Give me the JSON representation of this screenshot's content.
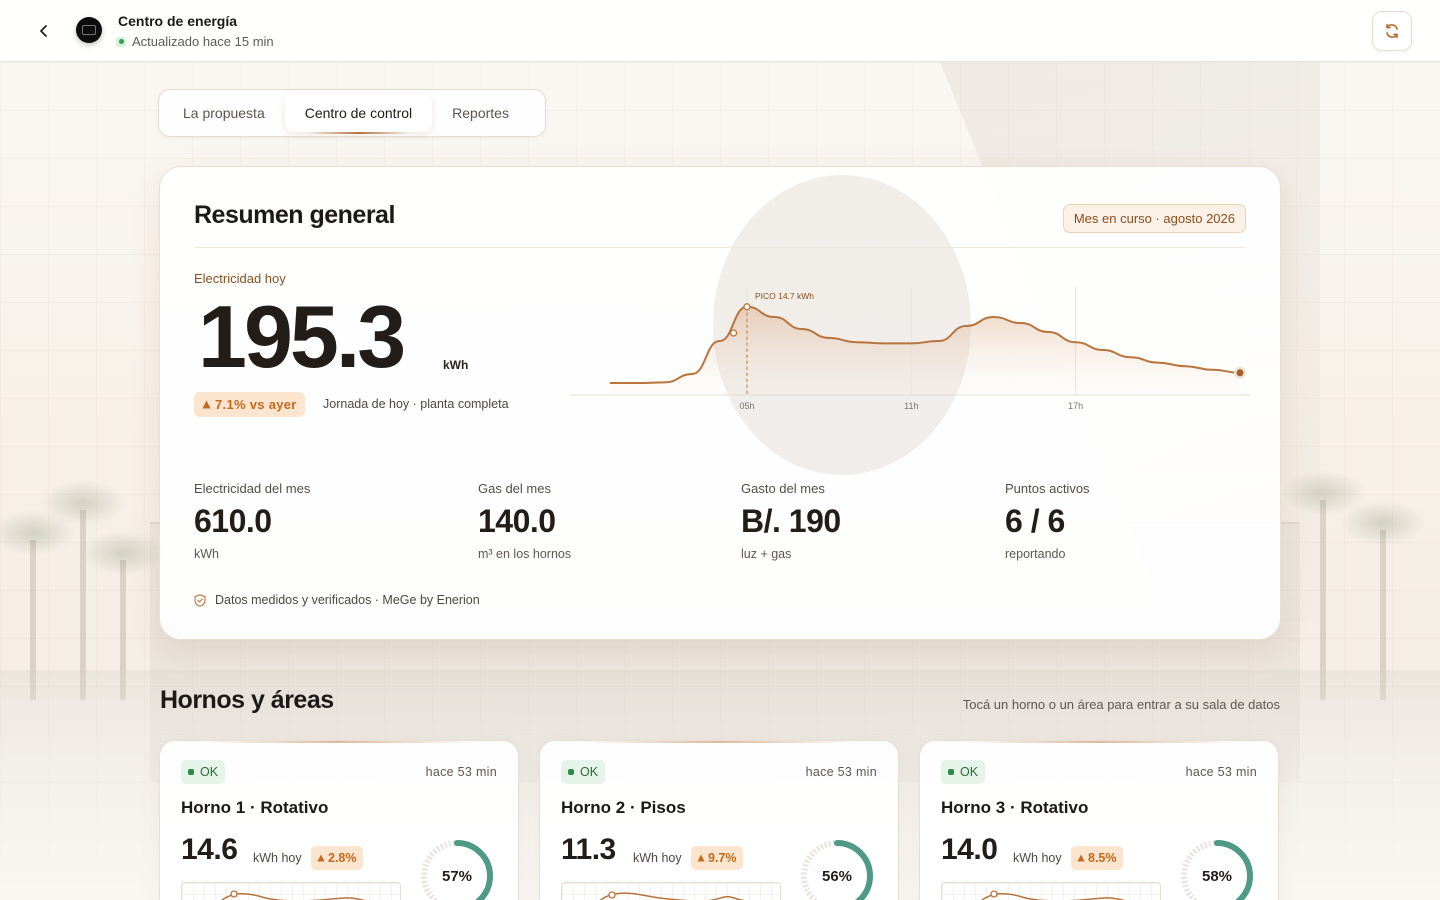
{
  "header": {
    "title": "Centro de energía",
    "status": "Actualizado hace 15 min"
  },
  "tabs": [
    {
      "label": "La propuesta",
      "active": false
    },
    {
      "label": "Centro de control",
      "active": true
    },
    {
      "label": "Reportes",
      "active": false
    }
  ],
  "summary": {
    "title": "Resumen general",
    "period": "Mes en curso · agosto 2026",
    "electricity_label": "Electricidad hoy",
    "electricity_value": "195.3",
    "electricity_unit": "kWh",
    "delta": "7.1% vs ayer",
    "delta_note": "Jornada de hoy · planta completa",
    "stats": [
      {
        "label": "Electricidad del mes",
        "value": "610.0",
        "sub": "kWh"
      },
      {
        "label": "Gas del mes",
        "value": "140.0",
        "sub": "m³ en los hornos"
      },
      {
        "label": "Gasto del mes",
        "value": "B/. 190",
        "sub": "luz + gas"
      },
      {
        "label": "Puntos activos",
        "value": "6 / 6",
        "sub": "reportando"
      }
    ],
    "verified": "Datos medidos y verificados · MeGe by Enerion"
  },
  "chart_data": {
    "type": "area",
    "peak_label": "PICO 14.7 kWh",
    "x_ticks": [
      "05h",
      "11h",
      "17h"
    ],
    "x": [
      0,
      1,
      2,
      3,
      4,
      5,
      6,
      7,
      8,
      9,
      10,
      11,
      12,
      13,
      14,
      15,
      16,
      17,
      18,
      19,
      20,
      21,
      22,
      23
    ],
    "series": [
      {
        "values": [
          2.0,
          2.0,
          2.1,
          3.5,
          9.0,
          14.7,
          13.0,
          11.0,
          9.5,
          8.8,
          8.6,
          8.6,
          9.0,
          11.5,
          13.0,
          12.0,
          10.5,
          8.8,
          7.5,
          6.3,
          5.4,
          4.8,
          4.2,
          3.7
        ]
      }
    ],
    "accent": "#b8743c"
  },
  "section": {
    "title": "Hornos y áreas",
    "hint": "Tocá un horno o un área para entrar a su sala de datos"
  },
  "ovens": [
    {
      "status": "OK",
      "time": "hace 53 min",
      "name": "Horno 1 · Rotativo",
      "kwh": "14.6",
      "unit": "kWh hoy",
      "delta": "2.8%",
      "ring": "57%",
      "ring_value": 0.57
    },
    {
      "status": "OK",
      "time": "hace 53 min",
      "name": "Horno 2 · Pisos",
      "kwh": "11.3",
      "unit": "kWh hoy",
      "delta": "9.7%",
      "ring": "56%",
      "ring_value": 0.56
    },
    {
      "status": "OK",
      "time": "hace 53 min",
      "name": "Horno 3 · Rotativo",
      "kwh": "14.0",
      "unit": "kWh hoy",
      "delta": "8.5%",
      "ring": "58%",
      "ring_value": 0.58
    }
  ]
}
